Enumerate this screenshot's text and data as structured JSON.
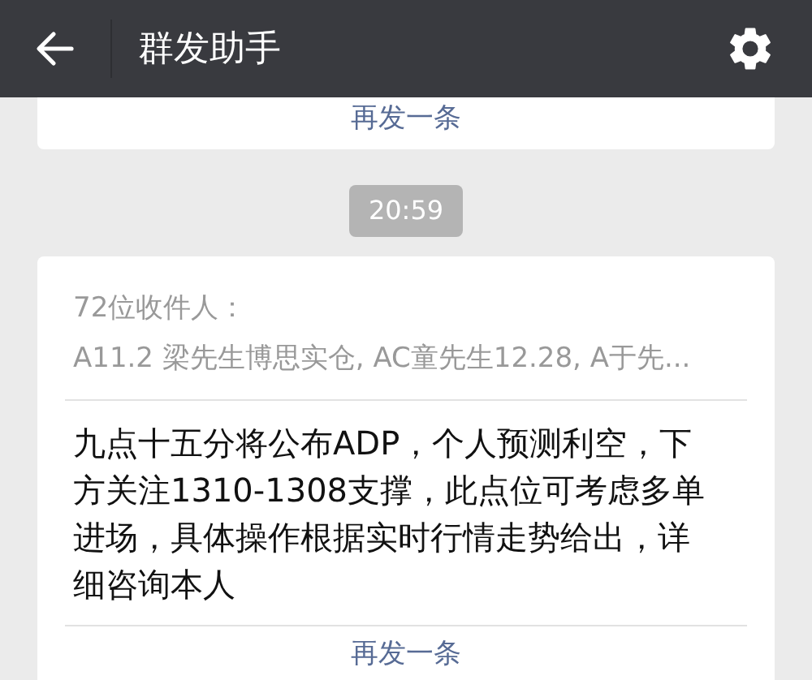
{
  "header": {
    "title": "群发助手"
  },
  "previous_message": {
    "resend": "再发一条"
  },
  "timestamp": "20:59",
  "message": {
    "recipients_count": "72位收件人：",
    "recipients": "A11.2 梁先生博思实仓, AC童先生12.28, A于先...",
    "text": "九点十五分将公布ADP，个人预测利空，下方关注1310-1308支撑，此点位可考虑多单进场，具体操作根据实时行情走势给出，详细咨询本人",
    "resend": "再发一条"
  }
}
